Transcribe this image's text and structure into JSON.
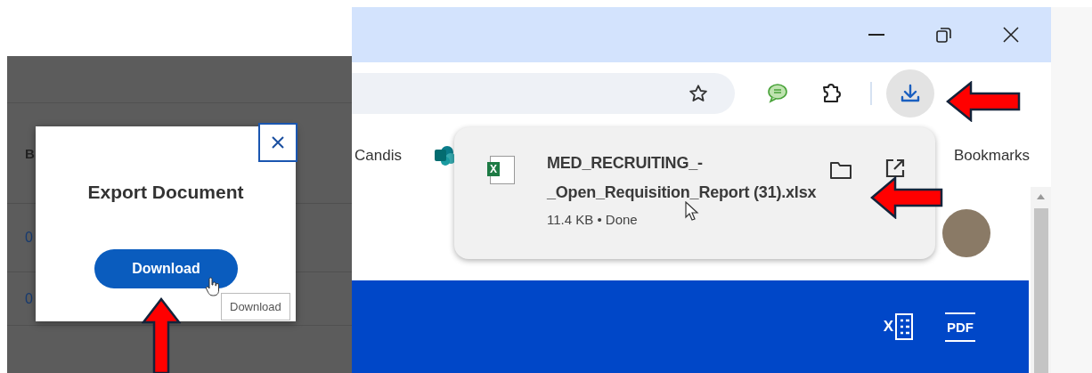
{
  "left_screen": {
    "table": {
      "header_cell": "B",
      "cells": [
        "0",
        "0"
      ]
    },
    "dialog": {
      "title": "Export Document",
      "download_button": "Download",
      "tooltip": "Download"
    }
  },
  "browser": {
    "bookmarks": {
      "items": [
        "Candis"
      ],
      "all_bookmarks": "Bookmarks"
    },
    "download_popup": {
      "file_icon_letter": "X",
      "file_name_lines": [
        "MED_RECRUITING_-",
        "_Open_Requisition_Report (31).xlsx"
      ],
      "status": "11.4 KB • Done"
    },
    "page_toolbar": {
      "excel_letter": "X",
      "pdf_label": "PDF"
    }
  }
}
